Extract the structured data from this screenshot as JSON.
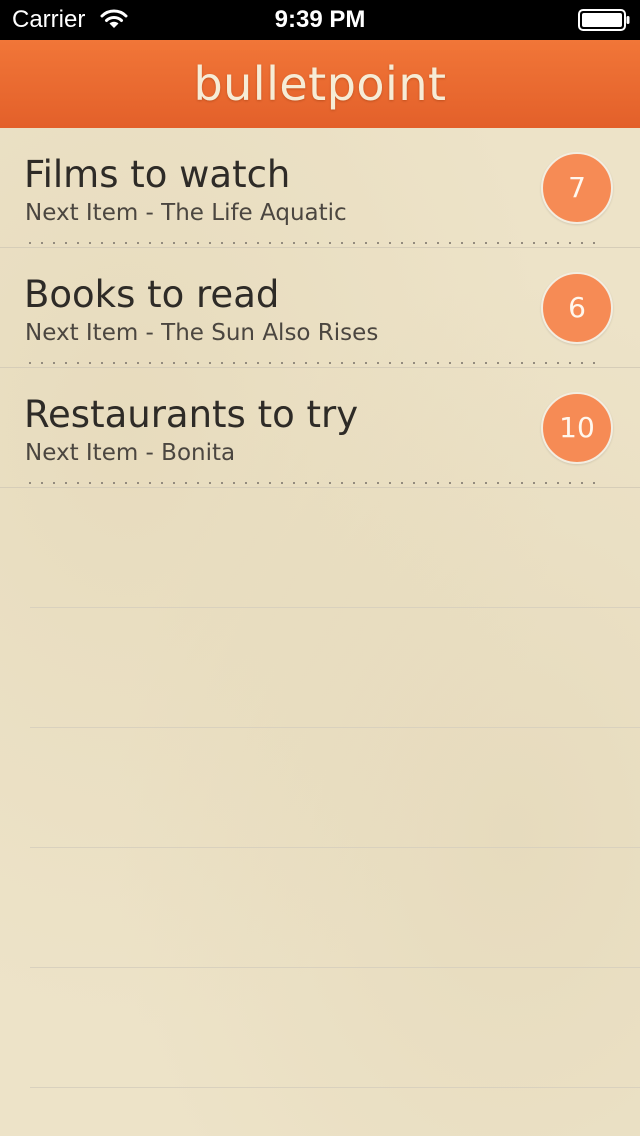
{
  "status_bar": {
    "carrier": "Carrier",
    "time": "9:39 PM",
    "icons": [
      "wifi-icon",
      "battery-icon"
    ]
  },
  "nav": {
    "title": "bulletpoint"
  },
  "lists": [
    {
      "title": "Films to watch",
      "subtitle": "Next Item - The Life Aquatic",
      "count": "7"
    },
    {
      "title": "Books to read",
      "subtitle": "Next Item - The Sun Also Rises",
      "count": "6"
    },
    {
      "title": "Restaurants to try",
      "subtitle": "Next Item - Bonita",
      "count": "10"
    }
  ],
  "colors": {
    "accent": "#ef6c30",
    "badge": "#f68b55",
    "paper": "#ede3c8",
    "text": "#2e2b27"
  }
}
